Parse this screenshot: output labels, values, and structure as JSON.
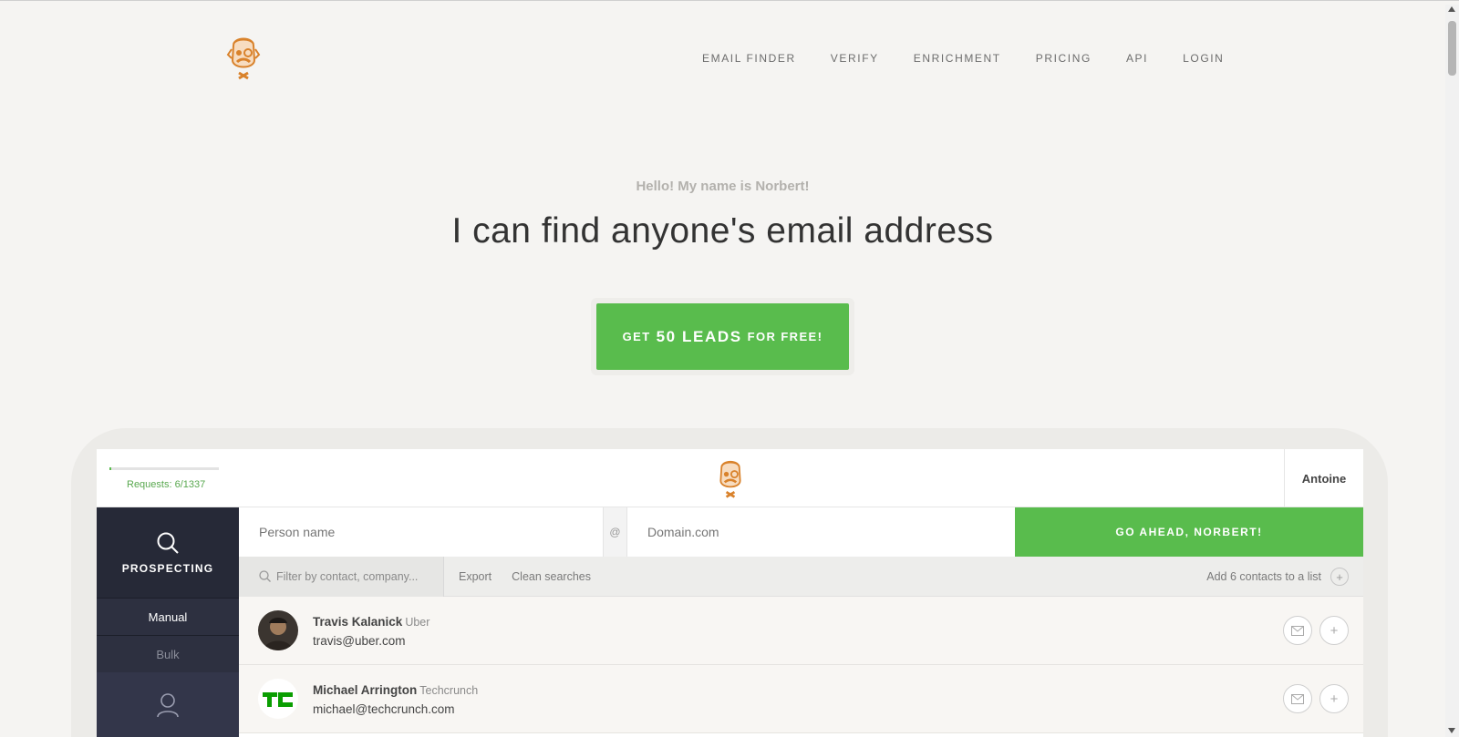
{
  "nav": {
    "items": [
      {
        "label": "EMAIL FINDER"
      },
      {
        "label": "VERIFY"
      },
      {
        "label": "ENRICHMENT"
      },
      {
        "label": "PRICING"
      },
      {
        "label": "API"
      },
      {
        "label": "LOGIN"
      }
    ]
  },
  "hero": {
    "greeting": "Hello! My name is Norbert!",
    "headline": "I can find anyone's email address",
    "cta": {
      "prefix": "GET",
      "highlight": "50 LEADS",
      "suffix": "FOR FREE!"
    }
  },
  "app": {
    "requests_label": "Requests: 6/1337",
    "requests_fraction": 0.0045,
    "user_name": "Antoine",
    "sidebar": {
      "prospecting_label": "PROSPECTING",
      "items": [
        {
          "label": "Manual",
          "active": true
        },
        {
          "label": "Bulk",
          "active": false
        }
      ]
    },
    "search": {
      "person_placeholder": "Person name",
      "at_symbol": "@",
      "domain_placeholder": "Domain.com",
      "go_label": "GO AHEAD, NORBERT!"
    },
    "toolbar": {
      "filter_placeholder": "Filter by contact, company...",
      "export_label": "Export",
      "clean_label": "Clean searches",
      "add_list_label": "Add 6 contacts to a list"
    },
    "contacts": [
      {
        "name": "Travis Kalanick",
        "company": "Uber",
        "email": "travis@uber.com"
      },
      {
        "name": "Michael Arrington",
        "company": "Techcrunch",
        "email": "michael@techcrunch.com"
      }
    ]
  },
  "colors": {
    "accent_green": "#59bc4d",
    "brand_orange": "#d9822b",
    "sidebar_dark": "#262937",
    "page_bg": "#f5f4f2"
  }
}
